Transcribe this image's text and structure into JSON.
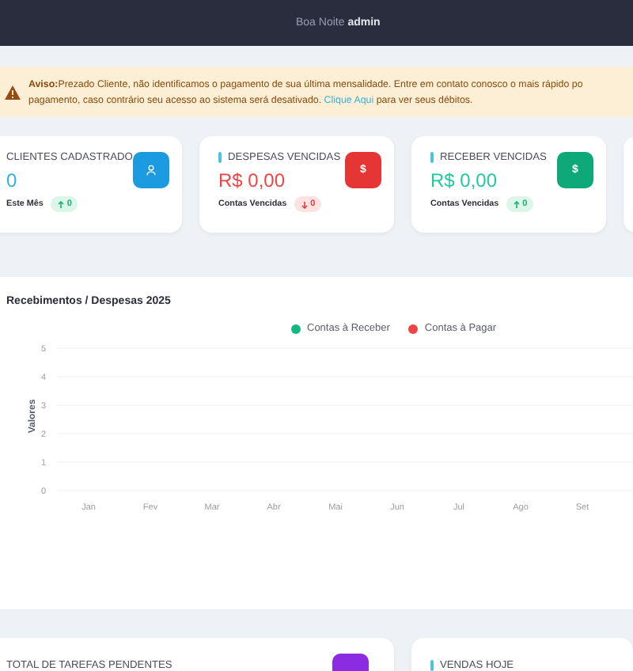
{
  "header": {
    "greeting": "Boa Noite",
    "user": "admin"
  },
  "alert": {
    "title": "Aviso:",
    "line_1": "Prezado Cliente, não identificamos o pagamento de sua última mensalidade. Entre em contato conosco o mais rápido po",
    "line_2": "pagamento, caso contrário seu acesso ao sistema será desativado.",
    "link": "Clique Aqui",
    "line_2_end": "para ver seus débitos."
  },
  "cards": [
    {
      "kind": "clients",
      "title": "CLIENTES CADASTRADO",
      "value": "0",
      "footer": "Este Mês",
      "badge": "0",
      "accent": false
    },
    {
      "kind": "expenses",
      "title": "DESPESAS VENCIDAS",
      "value": "R$ 0,00",
      "icon_text": "$",
      "footer": "Contas Vencidas",
      "badge": "0",
      "accent": true
    },
    {
      "kind": "receivables",
      "title": "RECEBER VENCIDAS",
      "value": "R$ 0,00",
      "icon_text": "$",
      "footer": "Contas Vencidas",
      "badge": "0",
      "accent": true
    }
  ],
  "chart": {
    "title": "Recebimentos / Despesas 2025",
    "chart_data": {
      "type": "line",
      "grid": true,
      "ylabel": "Valores",
      "categories": [
        "Jan",
        "Fev",
        "Mar",
        "Abr",
        "Mai",
        "Jun",
        "Jul",
        "Ago",
        "Set"
      ],
      "yticks": [
        0,
        1,
        2,
        3,
        4,
        5
      ],
      "ylim": [
        0,
        5
      ],
      "series": [
        {
          "name": "Contas à Receber",
          "color": "#10b981",
          "values": [
            null,
            null,
            null,
            null,
            null,
            null,
            null,
            null,
            null
          ]
        },
        {
          "name": "Contas à Pagar",
          "color": "#ef4444",
          "values": [
            null,
            null,
            null,
            null,
            null,
            null,
            null,
            null,
            null
          ]
        }
      ]
    }
  },
  "bottom_cards": [
    {
      "kind": "tasks",
      "title": "TOTAL DE TAREFAS PENDENTES",
      "accent": false
    },
    {
      "kind": "sales",
      "title": "VENDAS HOJE",
      "accent": true
    }
  ]
}
